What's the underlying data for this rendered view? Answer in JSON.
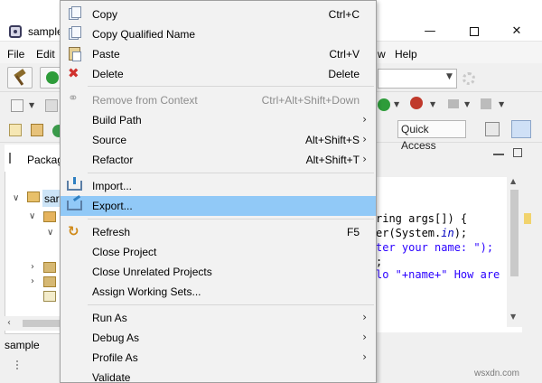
{
  "window": {
    "title": "sample",
    "minimize_glyph": "—",
    "close_glyph": "✕"
  },
  "menubar": {
    "items": [
      "File",
      "Edit",
      "w",
      "Help"
    ]
  },
  "toolbar": {
    "quick_access": "Quick Access"
  },
  "package_explorer": {
    "tab_label": "Packag",
    "project_label": "sar"
  },
  "editor": {
    "lines": [
      {
        "text": "ring args[]) {",
        "kind": "plain"
      },
      {
        "text": "er(System.",
        "kind": "plain",
        "field": "in",
        "after": ");"
      },
      {
        "text": "ter your name: \");",
        "kind": "str"
      },
      {
        "text": ";",
        "kind": "plain"
      },
      {
        "text": "lo \"+name+\" How are",
        "kind": "str"
      }
    ]
  },
  "status": {
    "text": "sample"
  },
  "watermark": "wsxdn.com",
  "context_menu": {
    "items": [
      {
        "label": "Copy",
        "shortcut": "Ctrl+C",
        "icon": "copy-icon"
      },
      {
        "label": "Copy Qualified Name",
        "shortcut": "",
        "icon": "copy-qualified-icon"
      },
      {
        "label": "Paste",
        "shortcut": "Ctrl+V",
        "icon": "paste-icon"
      },
      {
        "label": "Delete",
        "shortcut": "Delete",
        "icon": "delete-icon"
      },
      {
        "label": "Remove from Context",
        "shortcut": "Ctrl+Alt+Shift+Down",
        "icon": "remove-context-icon",
        "disabled": true
      },
      {
        "label": "Build Path",
        "shortcut": "",
        "submenu": true
      },
      {
        "label": "Source",
        "shortcut": "Alt+Shift+S",
        "submenu": true
      },
      {
        "label": "Refactor",
        "shortcut": "Alt+Shift+T",
        "submenu": true
      },
      {
        "label": "Import...",
        "shortcut": "",
        "icon": "import-icon"
      },
      {
        "label": "Export...",
        "shortcut": "",
        "icon": "export-icon",
        "highlighted": true
      },
      {
        "label": "Refresh",
        "shortcut": "F5",
        "icon": "refresh-icon"
      },
      {
        "label": "Close Project",
        "shortcut": ""
      },
      {
        "label": "Close Unrelated Projects",
        "shortcut": ""
      },
      {
        "label": "Assign Working Sets...",
        "shortcut": ""
      },
      {
        "label": "Run As",
        "shortcut": "",
        "submenu": true
      },
      {
        "label": "Debug As",
        "shortcut": "",
        "submenu": true
      },
      {
        "label": "Profile As",
        "shortcut": "",
        "submenu": true
      },
      {
        "label": "Validate",
        "shortcut": ""
      }
    ],
    "submenu_glyph": "›",
    "highlight_color": "#91c9f7"
  }
}
